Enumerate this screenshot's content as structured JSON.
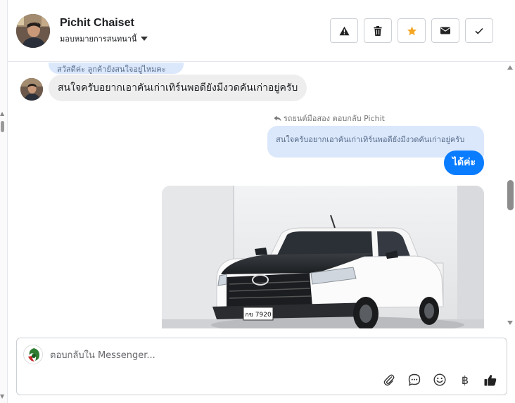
{
  "header": {
    "contact_name": "Pichit Chaiset",
    "assign_label": "มอบหมายการสนทนานี้",
    "actions": [
      {
        "name": "report-button",
        "icon": "warning-icon"
      },
      {
        "name": "delete-button",
        "icon": "trash-icon"
      },
      {
        "name": "star-button",
        "icon": "star-icon",
        "color": "#f5a623"
      },
      {
        "name": "mail-button",
        "icon": "envelope-icon"
      },
      {
        "name": "done-button",
        "icon": "check-icon"
      }
    ]
  },
  "messages": {
    "partial_text": "สวัสดีค่ะ ลูกค้ายังสนใจอยู่ไหมคะ",
    "incoming_text": "สนใจครับอยากเอาคันเก่าเทิร์นพอดียังมีงวดคันเก่าอยู่ครับ",
    "reply_meta": "รถยนต์มือสอง ตอบกลับ Pichit",
    "reply_quote": "สนใจครับอยากเอาคันเก่าเทิร์นพอดียังมีงวดคันเก่าอยู่ครับ",
    "outgoing_text": "ได้ค่ะ",
    "plate_text": "กข 7920"
  },
  "composer": {
    "placeholder": "ตอบกลับใน Messenger...",
    "tools": [
      "paperclip-icon",
      "chat-bubble-icon",
      "smiley-icon",
      "baht-icon",
      "thumbs-up-icon"
    ],
    "baht_symbol": "฿"
  },
  "colors": {
    "accent": "#0a7cff",
    "incoming_bg": "#eeeeee",
    "quote_bg": "#dbe8fc",
    "star": "#f5a623"
  }
}
